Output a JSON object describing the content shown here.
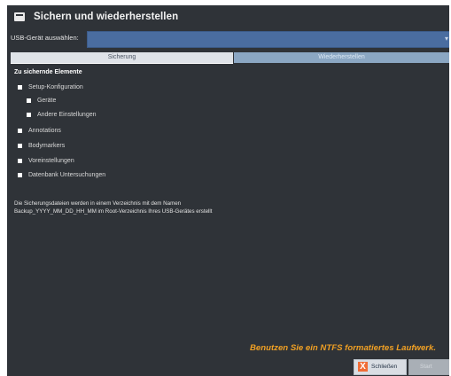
{
  "window": {
    "title": "Sichern und wiederherstellen"
  },
  "usb": {
    "label": "USB-Gerät auswählen:",
    "arrow": "▾"
  },
  "tabs": [
    {
      "label": "Sicherung",
      "active": true
    },
    {
      "label": "Wiederherstellen",
      "active": false
    }
  ],
  "content": {
    "section_title": "Zu sichernde Elemente",
    "items": [
      {
        "label": "Setup-Konfiguration"
      },
      {
        "label": "Geräte"
      },
      {
        "label": "Andere Einstellungen"
      },
      {
        "label": "Annotations"
      },
      {
        "label": "Bodymarkers"
      },
      {
        "label": "Voreinstellungen"
      },
      {
        "label": "Datenbank Untersuchungen"
      }
    ],
    "note_line1": "Die Sicherungsdateien werden in einem Verzeichnis mit dem Namen",
    "note_line2": "Backup_YYYY_MM_DD_HH_MM im Root-Verzeichnis Ihres USB-Gerätes erstellt"
  },
  "footer": {
    "message": "Benutzen Sie ein NTFS formatiertes Laufwerk.",
    "close_label": "Schließen",
    "close_icon": "X",
    "start_label": "Start"
  },
  "colors": {
    "background": "#2f3338",
    "accent": "#f0a024",
    "tab_active": "#dfe3e8",
    "tab_inactive": "#8ba7c3"
  }
}
